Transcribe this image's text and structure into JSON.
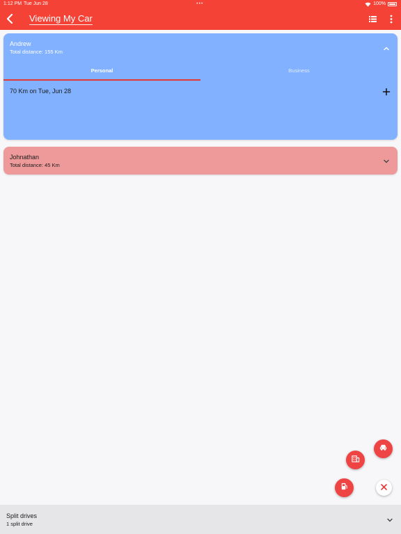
{
  "status_bar": {
    "time": "1:12 PM",
    "date": "Tue Jun 28",
    "battery": "100%",
    "icons": [
      "wifi-icon",
      "battery-icon"
    ]
  },
  "app_bar": {
    "title": "Viewing My Car",
    "icons": [
      "back-icon",
      "list-icon",
      "more-vertical-icon"
    ]
  },
  "drivers": [
    {
      "name": "Andrew",
      "total_distance": "Total distance: 155 Km",
      "expanded": true,
      "tabs": [
        {
          "label": "Personal",
          "selected": true
        },
        {
          "label": "Business",
          "selected": false
        }
      ],
      "entries": [
        {
          "text": "70 Km on Tue, Jun 28"
        }
      ]
    },
    {
      "name": "Johnathan",
      "total_distance": "Total distance: 45 Km",
      "expanded": false
    }
  ],
  "fab_menu": {
    "items": [
      "car-icon",
      "building-icon",
      "fuel-pump-icon"
    ],
    "close_icon": "close-icon"
  },
  "bottom_panel": {
    "title": "Split drives",
    "subtitle": "1 split drive"
  },
  "colors": {
    "app_bar": "#f44336",
    "card_andrew": "#82b1ff",
    "card_johnathan": "#ef9a9a",
    "fab": "#ef4444",
    "tab_indicator": "#e53935"
  }
}
